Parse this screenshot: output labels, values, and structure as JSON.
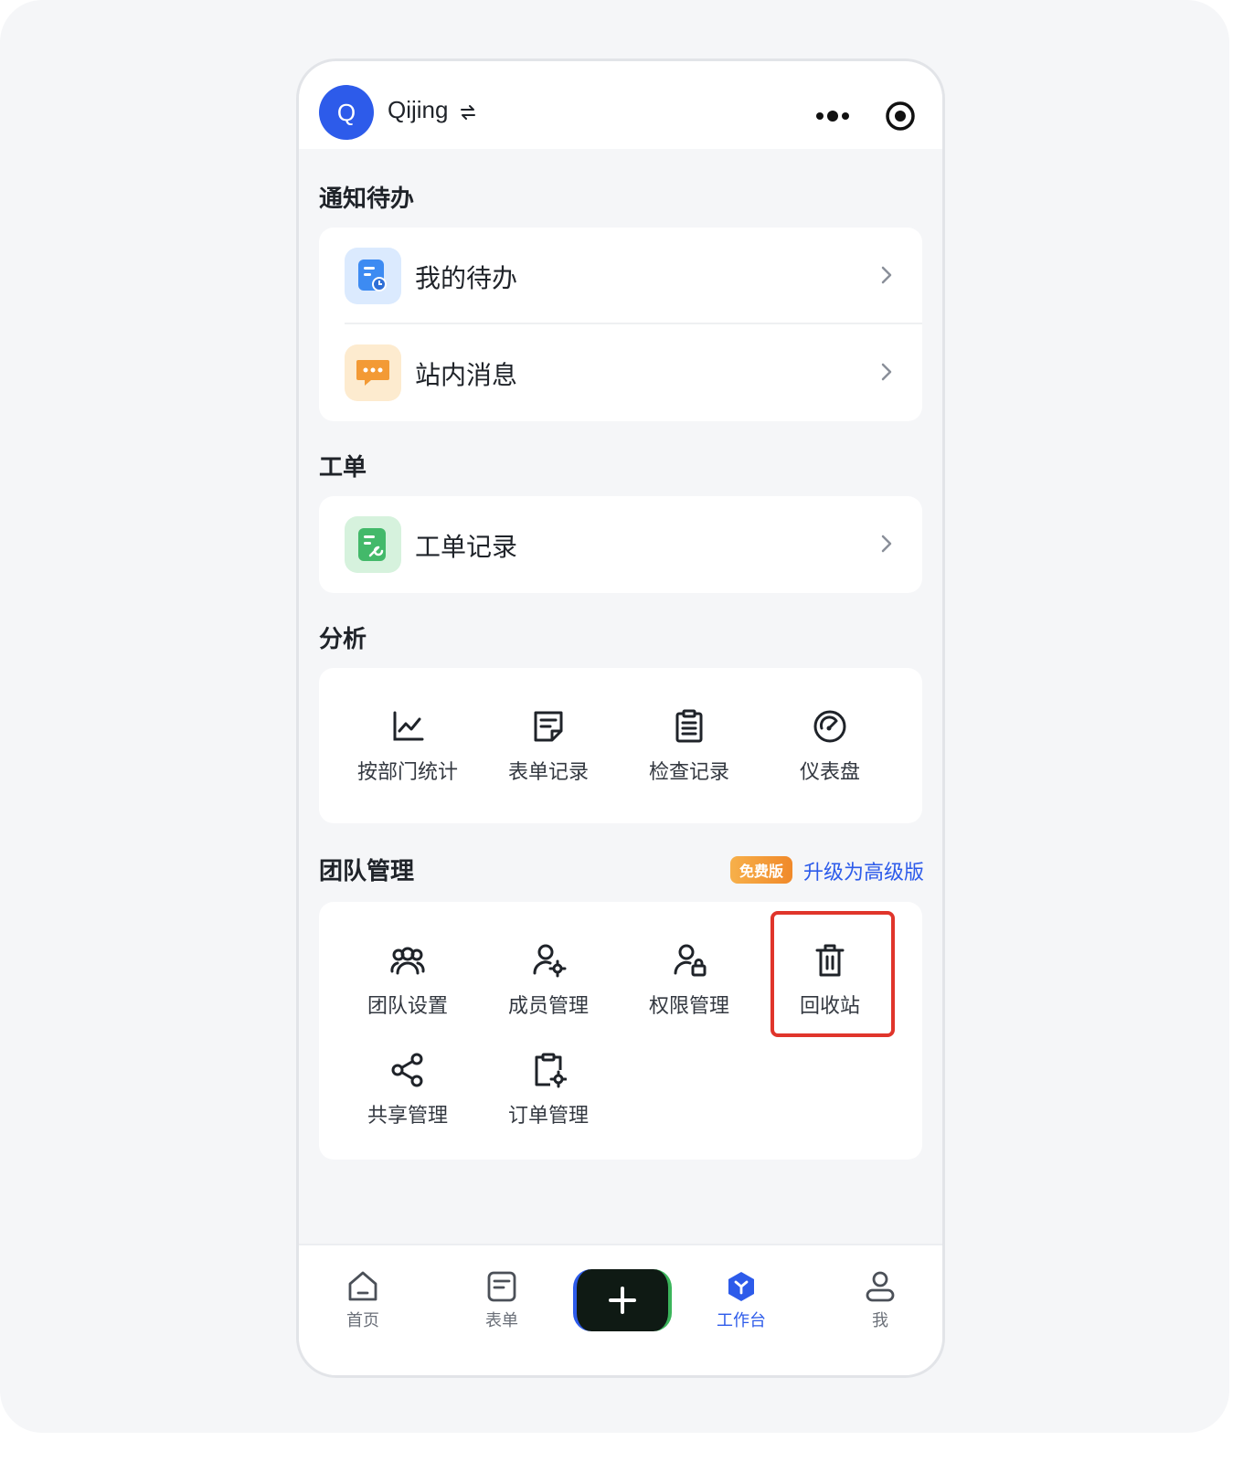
{
  "header": {
    "avatar_letter": "Q",
    "user_name": "Qijing",
    "switch_symbol": "⇄",
    "more_icon": "more-dots-icon",
    "target_icon": "record-target-icon"
  },
  "sections": {
    "notifications": {
      "title": "通知待办",
      "items": [
        {
          "label": "我的待办",
          "icon": "todo-clock-icon",
          "color": "#3d8bf2"
        },
        {
          "label": "站内消息",
          "icon": "message-bubble-icon",
          "color": "#f39a35"
        }
      ]
    },
    "work_orders": {
      "title": "工单",
      "items": [
        {
          "label": "工单记录",
          "icon": "wrench-doc-icon",
          "color": "#43b96a"
        }
      ]
    },
    "analysis": {
      "title": "分析",
      "items": [
        {
          "label": "按部门统计",
          "icon": "line-chart-icon"
        },
        {
          "label": "表单记录",
          "icon": "form-record-icon"
        },
        {
          "label": "检查记录",
          "icon": "checklist-icon"
        },
        {
          "label": "仪表盘",
          "icon": "gauge-icon"
        }
      ]
    },
    "team": {
      "title": "团队管理",
      "badge": "免费版",
      "upgrade": "升级为高级版",
      "items": [
        {
          "label": "团队设置",
          "icon": "team-icon"
        },
        {
          "label": "成员管理",
          "icon": "member-settings-icon"
        },
        {
          "label": "权限管理",
          "icon": "permission-icon"
        },
        {
          "label": "回收站",
          "icon": "trash-icon"
        },
        {
          "label": "共享管理",
          "icon": "share-icon"
        },
        {
          "label": "订单管理",
          "icon": "order-settings-icon"
        }
      ]
    }
  },
  "tabbar": {
    "tabs": [
      {
        "label": "首页",
        "icon": "home-icon"
      },
      {
        "label": "表单",
        "icon": "form-icon"
      },
      {
        "label": "工作台",
        "icon": "workbench-icon",
        "active": true
      },
      {
        "label": "我",
        "icon": "profile-icon"
      }
    ],
    "fab_icon": "plus-icon"
  },
  "colors": {
    "accent": "#2d5bea",
    "highlight": "#e0352b"
  }
}
